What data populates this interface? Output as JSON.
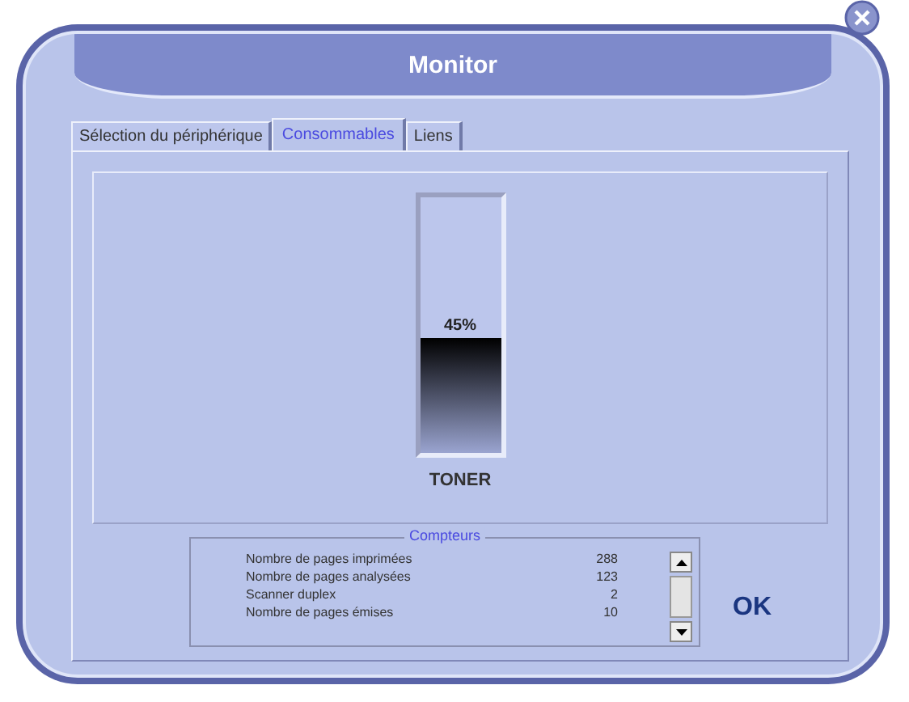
{
  "window": {
    "title": "Monitor"
  },
  "tabs": [
    {
      "label": "Sélection du périphérique",
      "selected": false
    },
    {
      "label": "Consommables",
      "selected": true
    },
    {
      "label": "Liens",
      "selected": false
    }
  ],
  "toner": {
    "level": 0.45,
    "reading": "45%",
    "label": "TONER"
  },
  "counters": {
    "title": "Compteurs",
    "rows": [
      {
        "name": "Nombre de pages imprimées",
        "value": "288"
      },
      {
        "name": "Nombre de pages analysées",
        "value": "123"
      },
      {
        "name": "Scanner duplex",
        "value": "2"
      },
      {
        "name": "Nombre de pages émises",
        "value": "10"
      }
    ]
  },
  "buttons": [
    "OK"
  ]
}
